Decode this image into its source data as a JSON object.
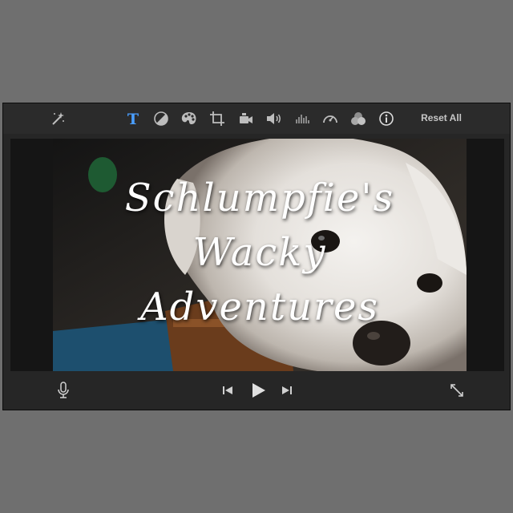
{
  "toolbar": {
    "icons": [
      "magic-wand-icon",
      "title-text-icon",
      "color-balance-icon",
      "color-correction-icon",
      "crop-icon",
      "stabilization-icon",
      "volume-icon",
      "noise-reduction-icon",
      "speed-icon",
      "clip-filter-icon",
      "info-icon"
    ],
    "reset_all_label": "Reset All",
    "active_color": "#4a9eff"
  },
  "viewer": {
    "title_lines": [
      "Schlumpfie's",
      "Wacky",
      "Adventures"
    ]
  },
  "controls": {
    "icons": [
      "microphone-icon",
      "skip-back-icon",
      "play-icon",
      "skip-forward-icon",
      "fullscreen-icon"
    ]
  }
}
